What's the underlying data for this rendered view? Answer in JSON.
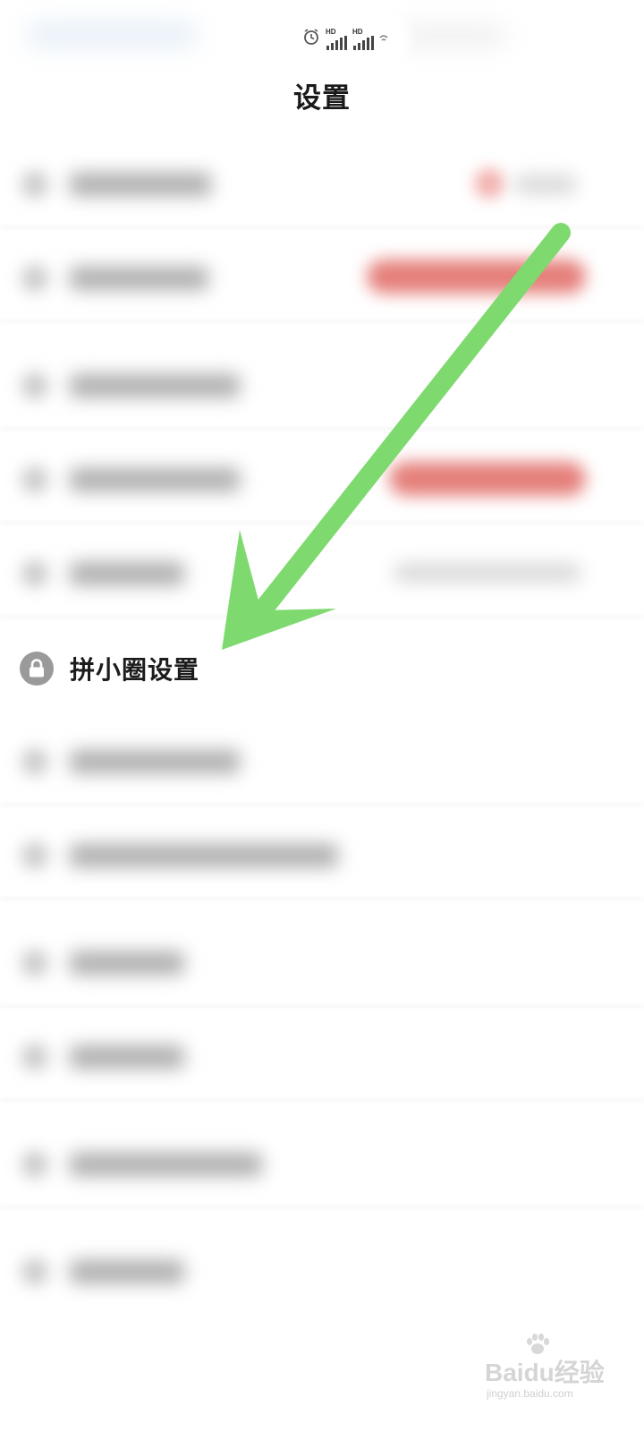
{
  "header": {
    "title": "设置"
  },
  "status_bar": {
    "signal_1_label": "HD",
    "signal_2_label": "HD"
  },
  "highlighted_item": {
    "label": "拼小圈设置",
    "icon": "lock-icon"
  },
  "annotation": {
    "type": "arrow",
    "color": "#7ed96f"
  },
  "watermark": {
    "main": "Baidu经验",
    "sub": "jingyan.baidu.com"
  },
  "colors": {
    "background": "#ffffff",
    "red_button": "#e57f7a",
    "title_text": "#1a1a1a"
  }
}
